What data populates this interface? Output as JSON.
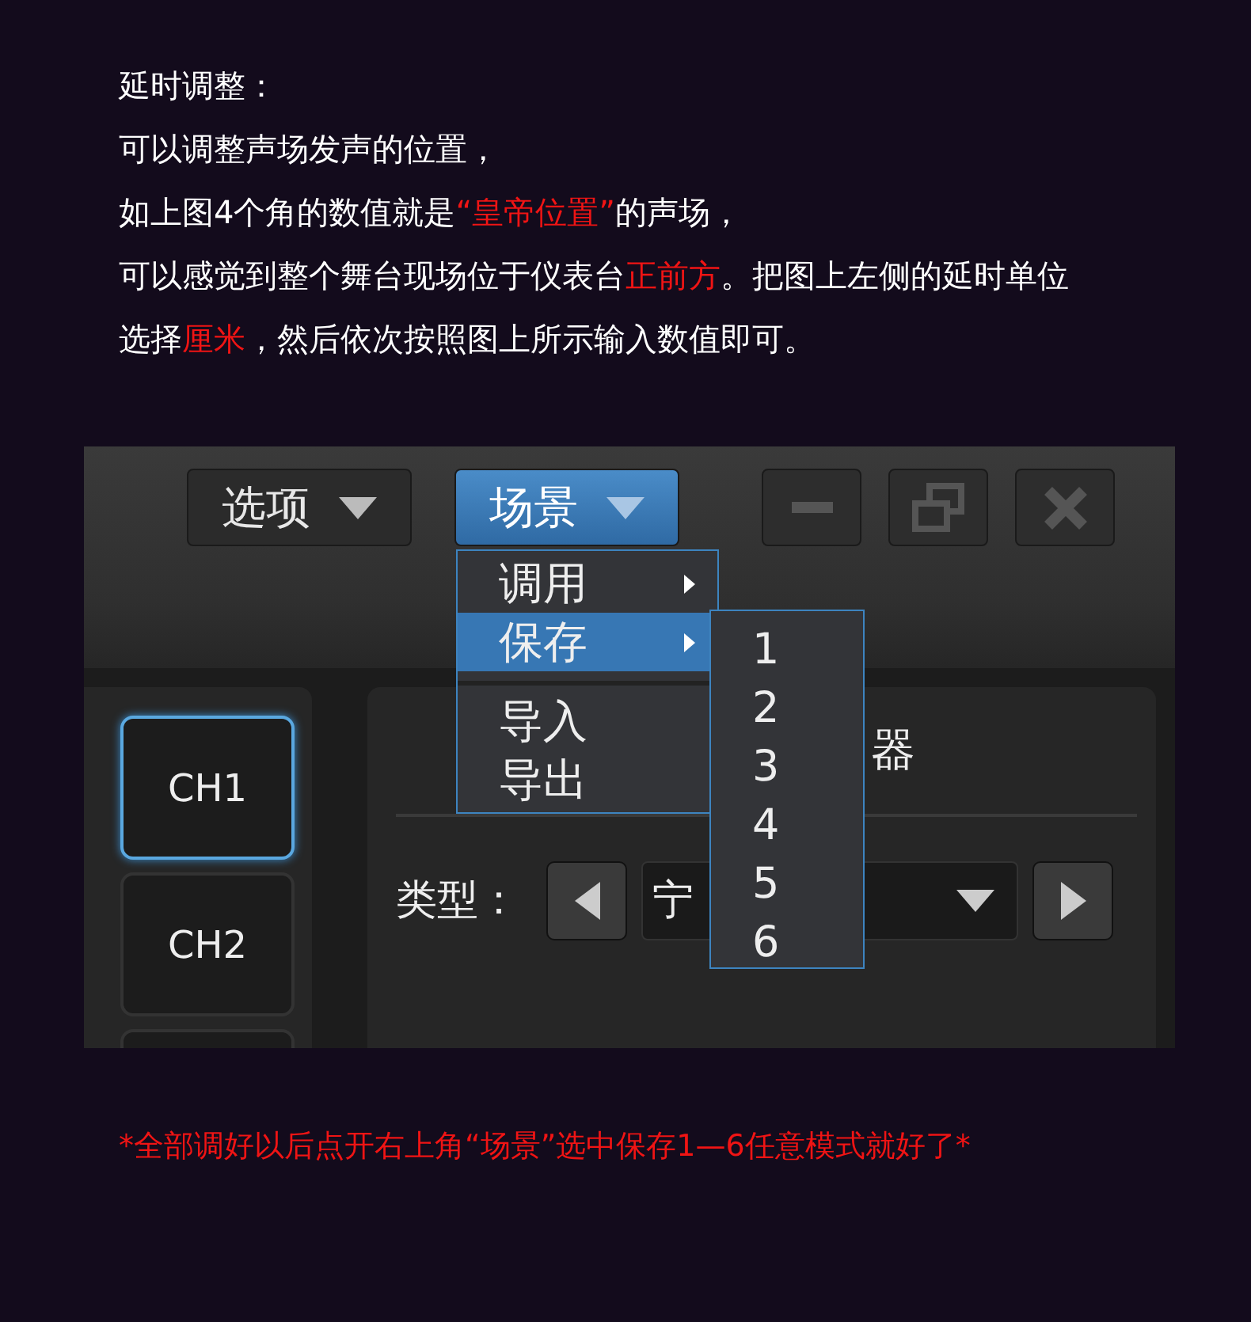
{
  "intro": {
    "lines": [
      {
        "segments": [
          {
            "text": "延时调整：",
            "highlight": false
          }
        ]
      },
      {
        "segments": [
          {
            "text": "可以调整声场发声的位置，",
            "highlight": false
          }
        ]
      },
      {
        "segments": [
          {
            "text": "如上图4个角的数值就是",
            "highlight": false
          },
          {
            "text": "“皇帝位置”",
            "highlight": true
          },
          {
            "text": "的声场，",
            "highlight": false
          }
        ]
      },
      {
        "segments": [
          {
            "text": "可以感觉到整个舞台现场位于仪表台",
            "highlight": false
          },
          {
            "text": "正前方",
            "highlight": true
          },
          {
            "text": "。把图上左侧的延时单位",
            "highlight": false
          }
        ]
      },
      {
        "segments": [
          {
            "text": "选择",
            "highlight": false
          },
          {
            "text": "厘米",
            "highlight": true
          },
          {
            "text": "，然后依次按照图上所示输入数值即可。",
            "highlight": false
          }
        ]
      }
    ]
  },
  "app": {
    "top_menus": [
      {
        "label": "选项",
        "selected": false
      },
      {
        "label": "场景",
        "selected": true
      }
    ],
    "channels": [
      {
        "label": "CH1",
        "selected": true
      },
      {
        "label": "CH2",
        "selected": false
      }
    ],
    "panel": {
      "title": "器",
      "type_label": "类型：",
      "type_value": "宁"
    },
    "menu": {
      "items": [
        {
          "kind": "item",
          "label": "调用",
          "submenu": true,
          "selected": false
        },
        {
          "kind": "item",
          "label": "保存",
          "submenu": true,
          "selected": true
        },
        {
          "kind": "divider"
        },
        {
          "kind": "item",
          "label": "导入",
          "submenu": false,
          "selected": false
        },
        {
          "kind": "item",
          "label": "导出",
          "submenu": false,
          "selected": false
        }
      ]
    },
    "submenu": {
      "items": [
        "1",
        "2",
        "3",
        "4",
        "5",
        "6"
      ]
    }
  },
  "footer_note": "*全部调好以后点开右上角“场景”选中保存1—6任意模式就好了*"
}
